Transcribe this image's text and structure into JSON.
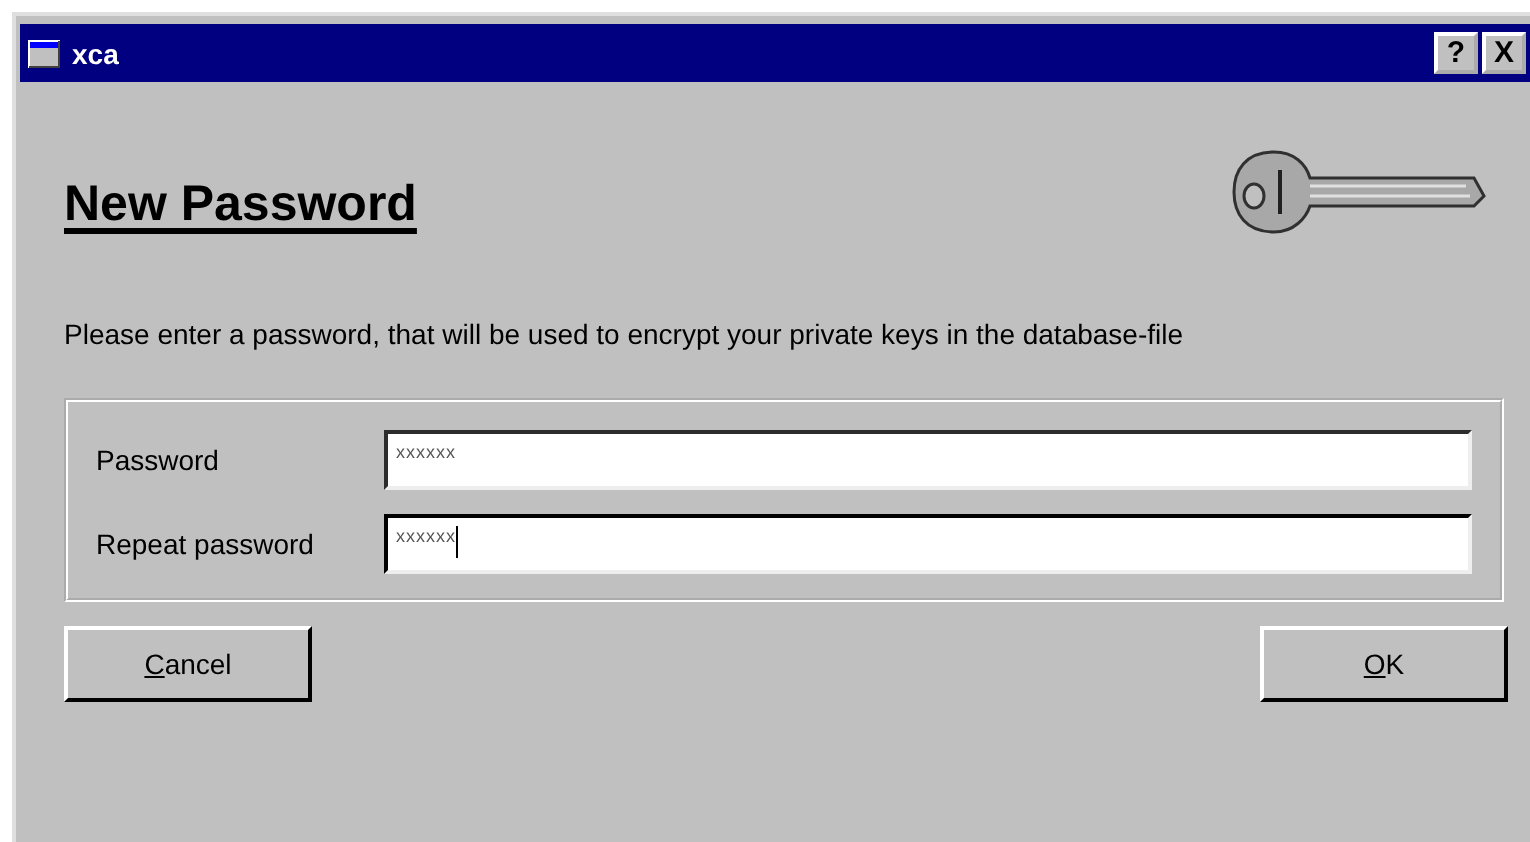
{
  "window": {
    "title": "xca",
    "buttons": [
      "?",
      "X"
    ]
  },
  "heading": "New Password",
  "instruction": "Please enter a password, that will be used to encrypt your private keys in the database-file",
  "fields": [
    {
      "label": "Password",
      "value": "xxxxxx",
      "focused": false
    },
    {
      "label": "Repeat password",
      "value": "xxxxxx",
      "focused": true
    }
  ],
  "buttons": [
    {
      "label": "Cancel",
      "underline_first": true
    },
    {
      "label": "OK",
      "underline_first": true
    }
  ]
}
